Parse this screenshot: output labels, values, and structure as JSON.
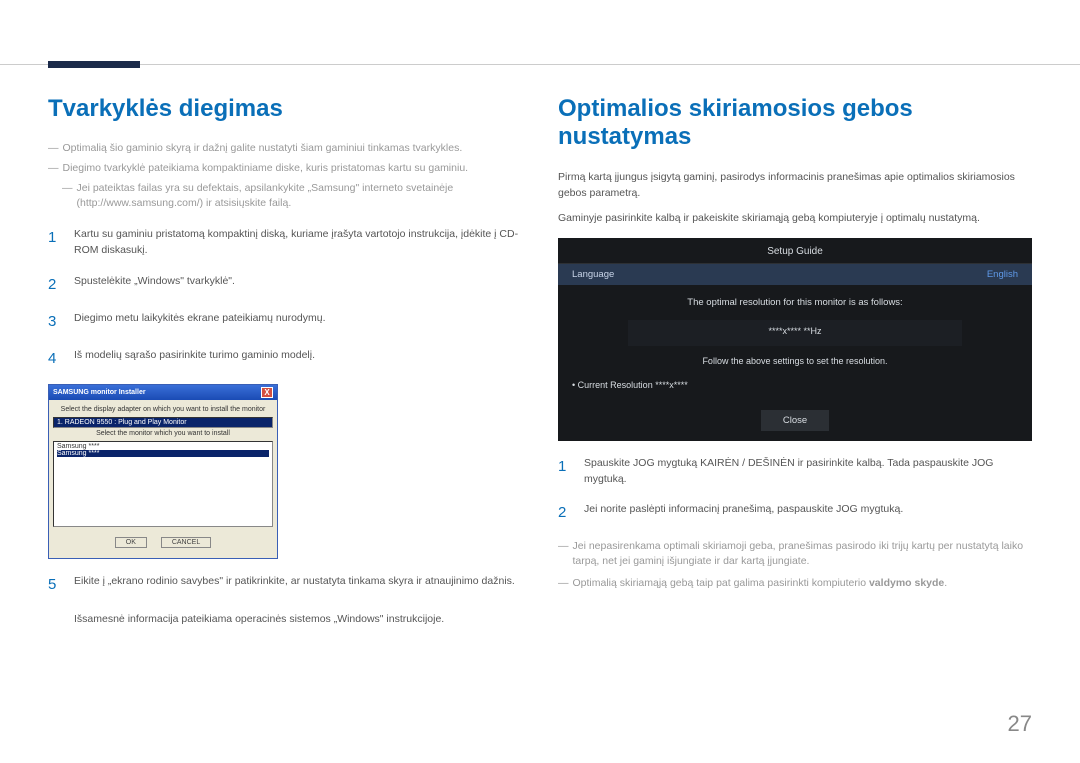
{
  "page_number": "27",
  "left": {
    "heading": "Tvarkyklės diegimas",
    "notes": [
      "Optimalią šio gaminio skyrą ir dažnį galite nustatyti šiam gaminiui tinkamas tvarkykles.",
      "Diegimo tvarkyklė pateikiama kompaktiniame diske, kuris pristatomas kartu su gaminiu.",
      "Jei pateiktas failas yra su defektais, apsilankykite „Samsung\" interneto svetainėje (http://www.samsung.com/) ir atsisiųskite failą."
    ],
    "steps": [
      "Kartu su gaminiu pristatomą kompaktinį diską, kuriame įrašyta vartotojo instrukcija, įdėkite į CD-ROM diskasukį.",
      "Spustelėkite „Windows\" tvarkyklė\".",
      "Diegimo metu laikykitės ekrane pateikiamų nurodymų.",
      "Iš modelių sąrašo pasirinkite turimo gaminio modelį."
    ],
    "installer": {
      "title": "SAMSUNG monitor Installer",
      "label1": "Select the display adapter on which you want to install the monitor",
      "dropdown": "1. RADEON 9550 : Plug and Play Monitor",
      "label2": "Select the monitor which you want to install",
      "listitems": [
        "Samsung ****",
        "Samsung ****"
      ],
      "ok": "OK",
      "cancel": "CANCEL"
    },
    "step5": "Eikite į „ekrano rodinio savybes\" ir patikrinkite, ar nustatyta tinkama skyra ir atnaujinimo dažnis.",
    "post": "Išsamesnė informacija pateikiama operacinės sistemos „Windows\" instrukcijoje."
  },
  "right": {
    "heading": "Optimalios skiriamosios gebos nustatymas",
    "intro1": "Pirmą kartą įjungus įsigytą gaminį, pasirodys informacinis pranešimas apie optimalios skiriamosios gebos parametrą.",
    "intro2": "Gaminyje pasirinkite kalbą ir pakeiskite skiriamąją gebą kompiuteryje į optimalų nustatymą.",
    "osd": {
      "title": "Setup Guide",
      "lang_label": "Language",
      "lang_value": "English",
      "msg": "The optimal resolution for this monitor is as follows:",
      "res": "****x**** **Hz",
      "follow": "Follow the above settings to set the resolution.",
      "current": "Current Resolution   ****x****",
      "close": "Close"
    },
    "steps": [
      "Spauskite JOG mygtuką KAIRĖN / DEŠINĖN ir pasirinkite kalbą. Tada paspauskite JOG mygtuką.",
      "Jei norite paslėpti informacinį pranešimą, paspauskite JOG mygtuką."
    ],
    "notes": [
      "Jei nepasirenkama optimali skiriamoji geba, pranešimas pasirodo iki trijų kartų per nustatytą laiko tarpą, net jei gaminį išjungiate ir dar kartą įjungiate."
    ],
    "note2_pre": "Optimalią skiriamąją gebą taip pat galima pasirinkti kompiuterio ",
    "note2_bold": "valdymo skyde",
    "note2_post": "."
  }
}
